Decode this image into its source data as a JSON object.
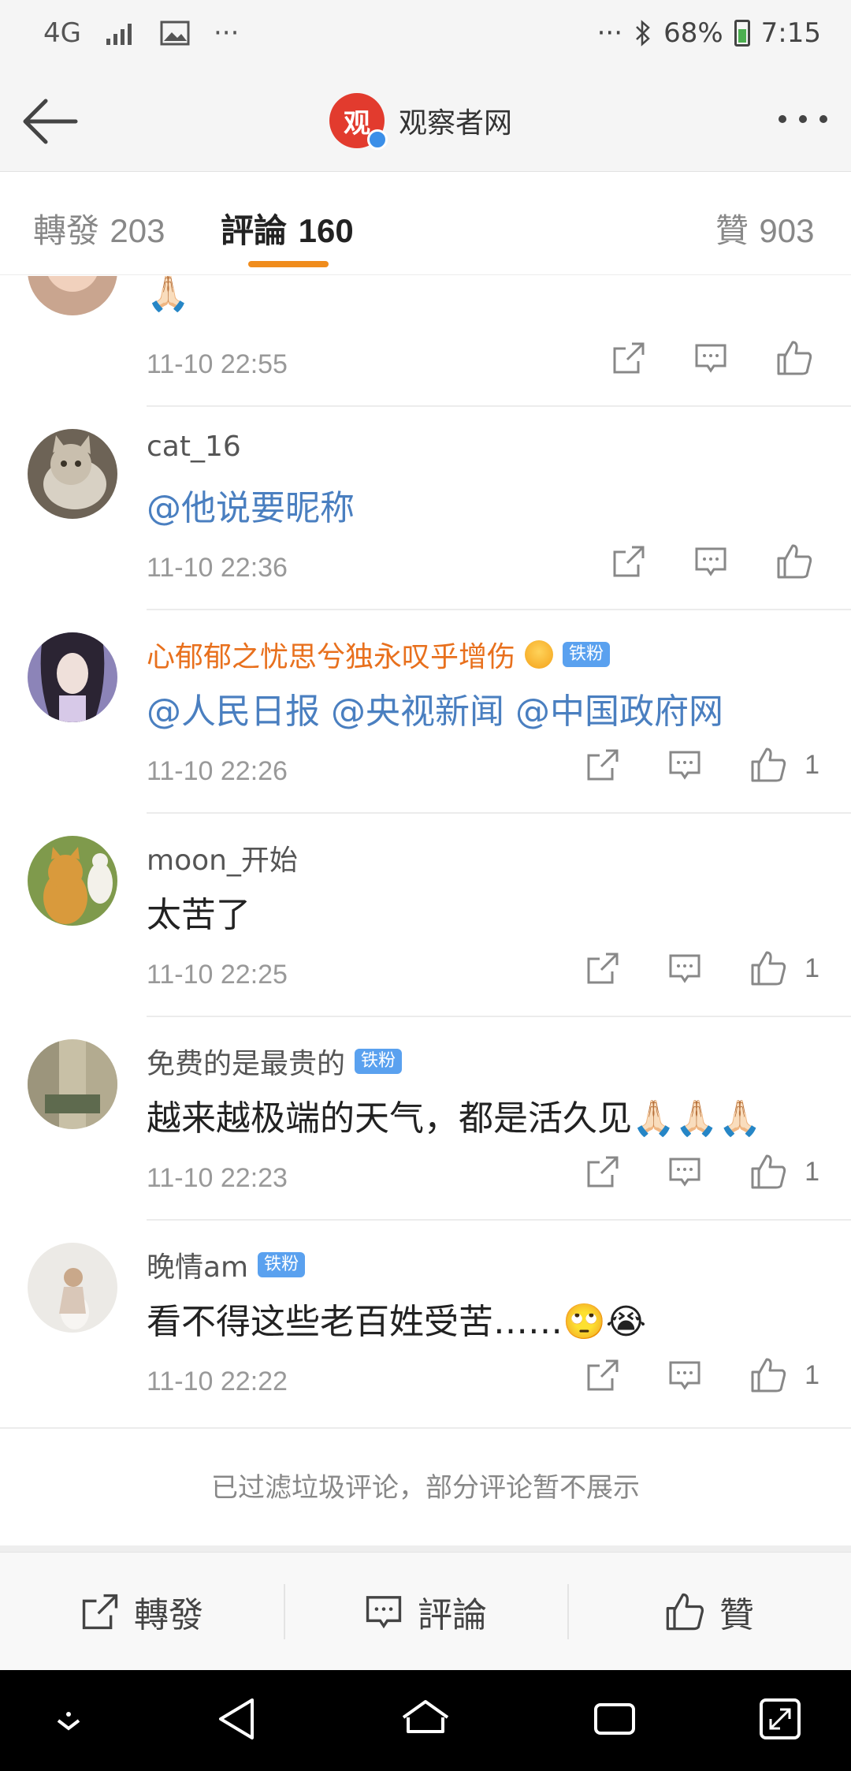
{
  "status_bar": {
    "network": "4G",
    "more_left": "···",
    "more_right": "···",
    "battery": "68%",
    "time": "7:15"
  },
  "header": {
    "title": "观察者网",
    "logo_text": "观"
  },
  "tabs": [
    {
      "label": "轉發",
      "count": "203"
    },
    {
      "label": "評論",
      "count": "160"
    },
    {
      "label": "贊",
      "count": "903"
    }
  ],
  "comments": [
    {
      "name": "",
      "text": "🙏🏻",
      "time": "11-10 22:55",
      "likes": "",
      "name_style": "normal",
      "text_style": "normal",
      "badge": ""
    },
    {
      "name": "cat_16",
      "text": "@他说要昵称",
      "time": "11-10 22:36",
      "likes": "",
      "name_style": "normal",
      "text_style": "link",
      "badge": ""
    },
    {
      "name": "心郁郁之忧思兮独永叹乎增伤",
      "text": "@人民日报  @央视新闻 @中国政府网",
      "time": "11-10 22:26",
      "likes": "1",
      "name_style": "orange",
      "text_style": "link",
      "badge": "铁粉"
    },
    {
      "name": "moon_开始",
      "text": "太苦了",
      "time": "11-10 22:25",
      "likes": "1",
      "name_style": "normal",
      "text_style": "normal",
      "badge": ""
    },
    {
      "name": "免费的是最贵的",
      "text": "越来越极端的天气，都是活久见🙏🏻🙏🏻🙏🏻",
      "time": "11-10 22:23",
      "likes": "1",
      "name_style": "normal",
      "text_style": "normal",
      "badge": "铁粉"
    },
    {
      "name": "晚情am",
      "text": "看不得这些老百姓受苦……🙄😭",
      "time": "11-10 22:22",
      "likes": "1",
      "name_style": "normal",
      "text_style": "normal",
      "badge": "铁粉"
    }
  ],
  "filter_note": "已过滤垃圾评论，部分评论暂不展示",
  "bottom_bar": {
    "repost": "轉發",
    "comment": "評論",
    "like": "贊"
  },
  "colors": {
    "accent": "#f08c1c",
    "link": "#4a7fc0",
    "vip_name": "#e8701d",
    "badge": "#5aa1ef"
  }
}
